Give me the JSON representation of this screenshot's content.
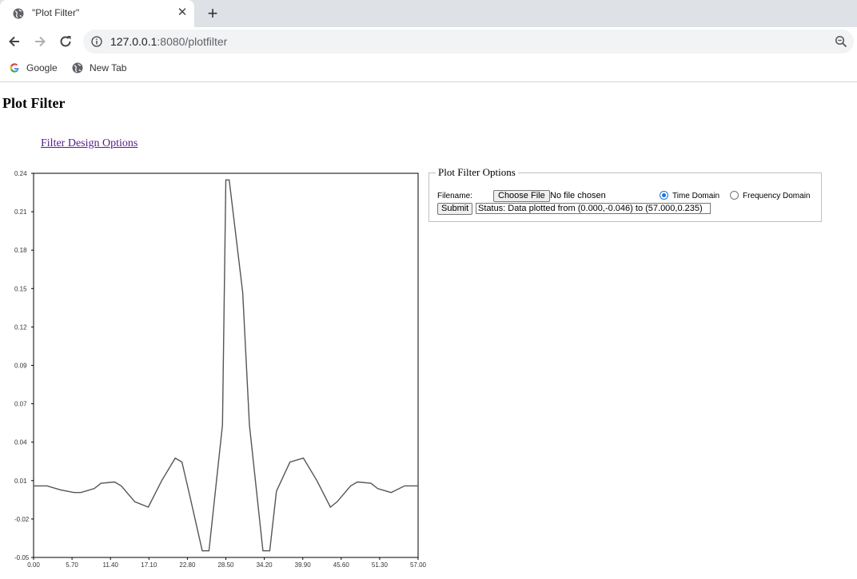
{
  "browser": {
    "tab_title": "\"Plot Filter\"",
    "url_host": "127.0.0.1",
    "url_rest": ":8080/plotfilter",
    "bookmarks": [
      {
        "label": "Google",
        "icon": "google-icon"
      },
      {
        "label": "New Tab",
        "icon": "globe-icon"
      }
    ]
  },
  "page": {
    "title": "Plot Filter",
    "design_link": "Filter Design Options"
  },
  "options": {
    "legend": "Plot Filter Options",
    "filename_label": "Filename:",
    "choose_file_label": "Choose File",
    "no_file_text": "No file chosen",
    "time_domain_label": "Time Domain",
    "frequency_domain_label": "Frequency Domain",
    "selected_domain": "Time Domain",
    "submit_label": "Submit",
    "status_text": "Status: Data plotted from (0.000,-0.046) to (57.000,0.235)"
  },
  "chart_data": {
    "type": "line",
    "title": "",
    "xlabel": "",
    "ylabel": "",
    "xlim": [
      0,
      57
    ],
    "ylim": [
      -0.05,
      0.24
    ],
    "x_ticks": [
      "0.00",
      "5.70",
      "11.40",
      "17.10",
      "22.80",
      "28.50",
      "34.20",
      "39.90",
      "45.60",
      "51.30",
      "57.00"
    ],
    "y_ticks": [
      "-0.05",
      "-0.02",
      "0.01",
      "0.04",
      "0.07",
      "0.09",
      "0.12",
      "0.15",
      "0.18",
      "0.21",
      "0.24"
    ],
    "grid": false,
    "color": "#555555",
    "series": [
      {
        "x": [
          0,
          2,
          4,
          6,
          7,
          9,
          10,
          12,
          13,
          15,
          17,
          19,
          21,
          22,
          23,
          25,
          26,
          28,
          28.5,
          29,
          31,
          32,
          34,
          35,
          36,
          38,
          40,
          42,
          44,
          45,
          47,
          48,
          50,
          51,
          53,
          55,
          57
        ],
        "y": [
          0.004,
          0.004,
          0.001,
          -0.001,
          -0.001,
          0.002,
          0.006,
          0.007,
          0.004,
          -0.008,
          -0.012,
          0.008,
          0.025,
          0.022,
          0.0,
          -0.045,
          -0.045,
          0.05,
          0.235,
          0.235,
          0.15,
          0.05,
          -0.045,
          -0.045,
          0.0,
          0.022,
          0.025,
          0.008,
          -0.012,
          -0.008,
          0.004,
          0.007,
          0.006,
          0.002,
          -0.001,
          0.004,
          0.004
        ]
      }
    ]
  }
}
